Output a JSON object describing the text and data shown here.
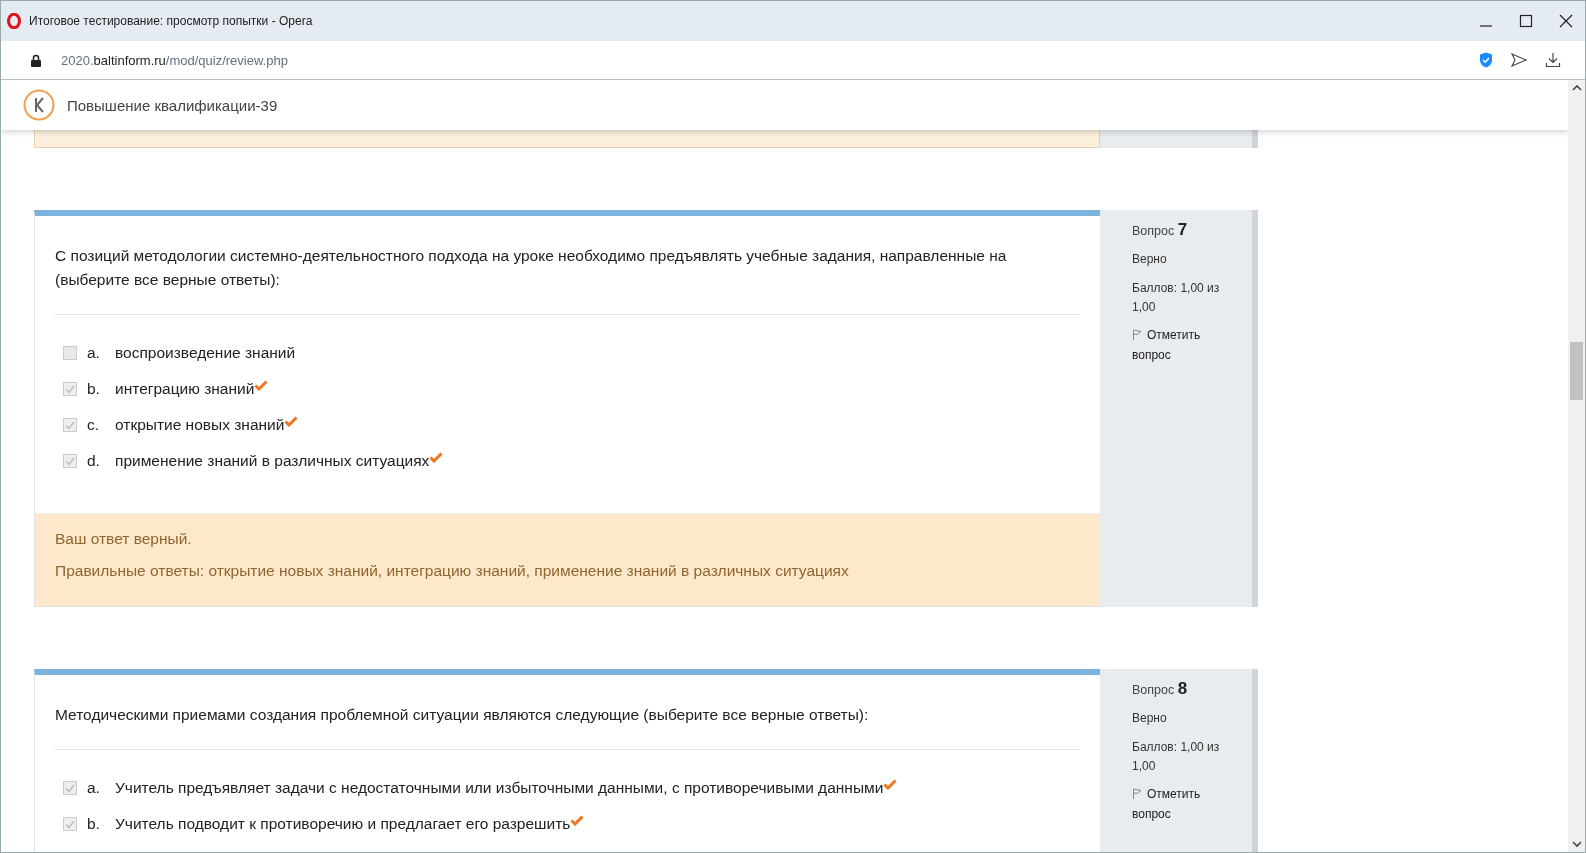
{
  "window": {
    "title": "Итоговое тестирование: просмотр попытки - Opera"
  },
  "address": {
    "prefix": "2020.",
    "domain": "baltinform.ru",
    "path": "/mod/quiz/review.php"
  },
  "site": {
    "title": "Повышение квалификации-39"
  },
  "questions": [
    {
      "label": "Вопрос",
      "number": "7",
      "status": "Верно",
      "grade": "Баллов: 1,00 из 1,00",
      "flag": "Отметить вопрос",
      "text": "С позиций методологии системно-деятельностного подхода на уроке необходимо предъявлять учебные задания, направленные на (выберите все верные ответы):",
      "options": [
        {
          "letter": "a.",
          "text": "воспроизведение знаний",
          "checked": false,
          "correct": false
        },
        {
          "letter": "b.",
          "text": "интеграцию знаний",
          "checked": true,
          "correct": true
        },
        {
          "letter": "c.",
          "text": "открытие новых знаний",
          "checked": true,
          "correct": true
        },
        {
          "letter": "d.",
          "text": "применение знаний в различных ситуациях",
          "checked": true,
          "correct": true
        }
      ],
      "feedback": {
        "message": "Ваш ответ верный.",
        "right_answer": "Правильные ответы: открытие новых знаний, интеграцию знаний, применение знаний в различных ситуациях"
      }
    },
    {
      "label": "Вопрос",
      "number": "8",
      "status": "Верно",
      "grade": "Баллов: 1,00 из 1,00",
      "flag": "Отметить вопрос",
      "text": "Методическими приемами создания проблемной ситуации являются следующие (выберите все верные ответы):",
      "options": [
        {
          "letter": "a.",
          "text": "Учитель предъявляет задачи с недостаточными или избыточными данными, с противоречивыми данными",
          "checked": true,
          "correct": true
        },
        {
          "letter": "b.",
          "text": "Учитель подводит к противоречию и предлагает его разрешить",
          "checked": true,
          "correct": true
        }
      ]
    }
  ]
}
